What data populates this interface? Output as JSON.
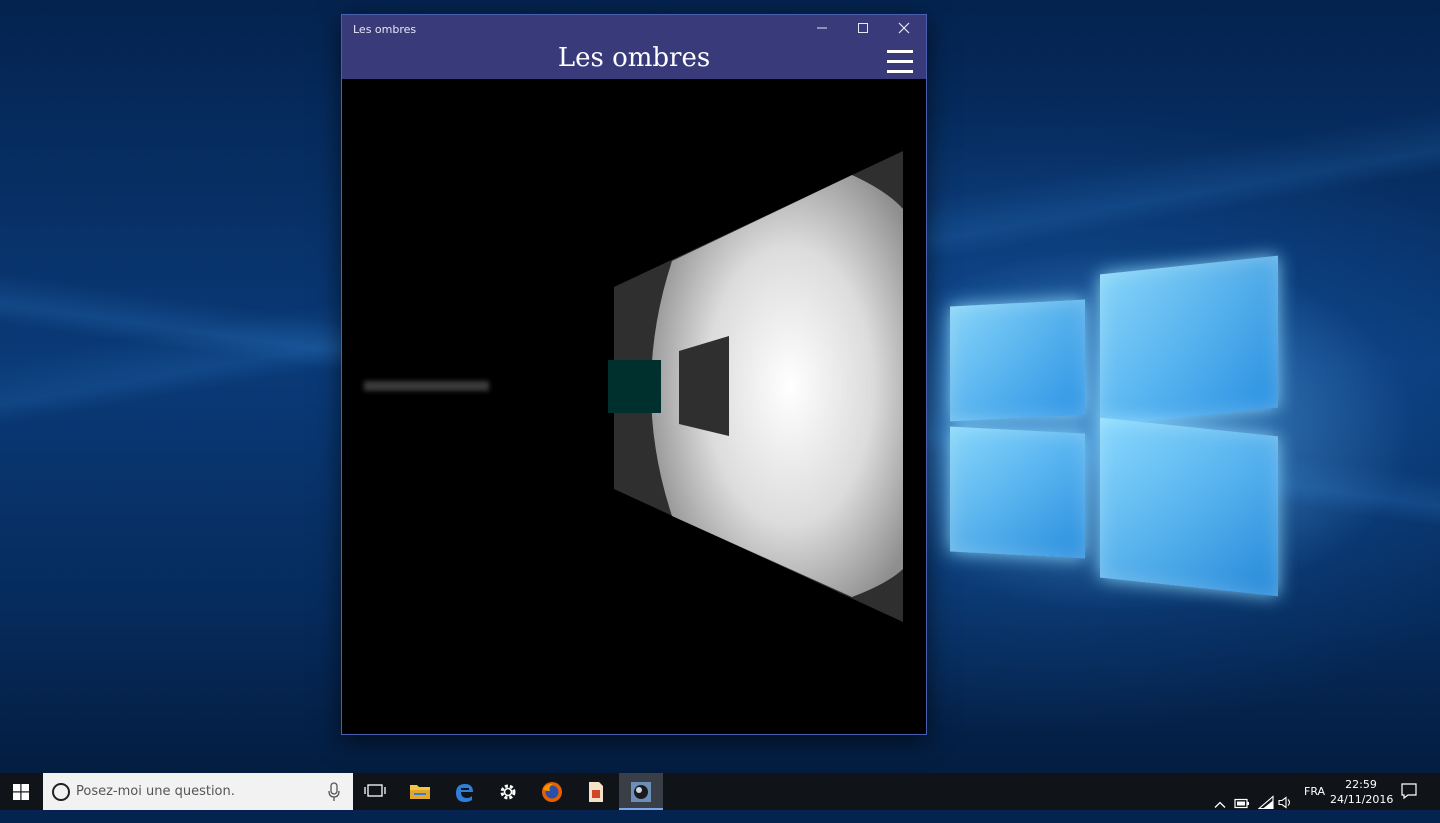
{
  "window": {
    "title": "Les ombres",
    "app_title": "Les ombres",
    "controls": {
      "minimize": "minimize-icon",
      "maximize": "maximize-icon",
      "close": "close-icon",
      "menu": "hamburger-menu-icon"
    }
  },
  "taskbar": {
    "search_placeholder": "Posez-moi une question.",
    "language": "FRA",
    "time": "22:59",
    "date": "24/11/2016",
    "icons": [
      "windows-start-icon",
      "cortana-icon",
      "microphone-icon",
      "task-view-icon",
      "file-explorer-icon",
      "edge-icon",
      "settings-gear-icon",
      "firefox-icon",
      "document-app-icon",
      "shadows-app-icon",
      "chevron-up-icon",
      "battery-icon",
      "wifi-icon",
      "volume-icon",
      "action-center-icon"
    ]
  },
  "colors": {
    "title_bar": "#383a7a",
    "scene_background": "#000000",
    "cube": "#00302e",
    "shadow": "#2f2f2f"
  }
}
